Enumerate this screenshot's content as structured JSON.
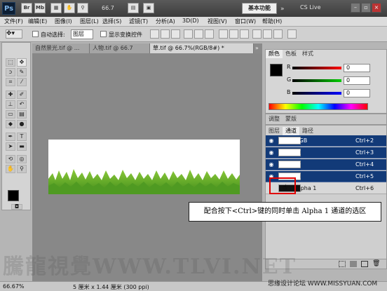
{
  "appbar": {
    "logo": "Ps",
    "icons": [
      "Br",
      "Mb"
    ],
    "zoom": "66.7",
    "workspace_button": "基本功能",
    "cs_live": "CS Live"
  },
  "menubar": [
    "文件(F)",
    "编辑(E)",
    "图像(I)",
    "图层(L)",
    "选择(S)",
    "滤镜(T)",
    "分析(A)",
    "3D(D)",
    "视图(V)",
    "窗口(W)",
    "帮助(H)"
  ],
  "options": {
    "auto_select_label": "自动选择:",
    "auto_select_value": "图层",
    "show_transform_label": "显示变换控件"
  },
  "tabs": [
    {
      "label": "自然景光.tif @ ..."
    },
    {
      "label": "人物.tif @ 66.7"
    },
    {
      "label": "草.tif @ 66.7%(RGB/8#) *"
    }
  ],
  "status": {
    "zoom": "66.67%",
    "info": "5 厘米 x 1.44 厘米 (300 ppi)"
  },
  "color_panel": {
    "tabs": [
      "颜色",
      "色板",
      "样式"
    ],
    "channels": [
      {
        "label": "R",
        "value": "0"
      },
      {
        "label": "G",
        "value": "0"
      },
      {
        "label": "B",
        "value": "0"
      }
    ]
  },
  "adjust_panel": {
    "tabs": [
      "调整",
      "蒙版"
    ]
  },
  "channels_panel": {
    "tabs": [
      "图层",
      "通道",
      "路径"
    ],
    "rows": [
      {
        "name": "RGB",
        "shortcut": "Ctrl+2"
      },
      {
        "name": "红",
        "shortcut": "Ctrl+3"
      },
      {
        "name": "绿",
        "shortcut": "Ctrl+4"
      },
      {
        "name": "蓝",
        "shortcut": "Ctrl+5"
      },
      {
        "name": "Alpha 1",
        "shortcut": "Ctrl+6"
      }
    ]
  },
  "callout": "配合按下<Ctrl>键的同时单击 Alpha 1 通道的选区",
  "watermark": "騰龍視覺WWW.TLVI.NET",
  "forum": "思缘设计论坛  WWW.MISSYUAN.COM",
  "colors": {
    "selection_blue": "#123a78",
    "highlight_red": "#e00000",
    "grass_green": "#5aa327"
  }
}
